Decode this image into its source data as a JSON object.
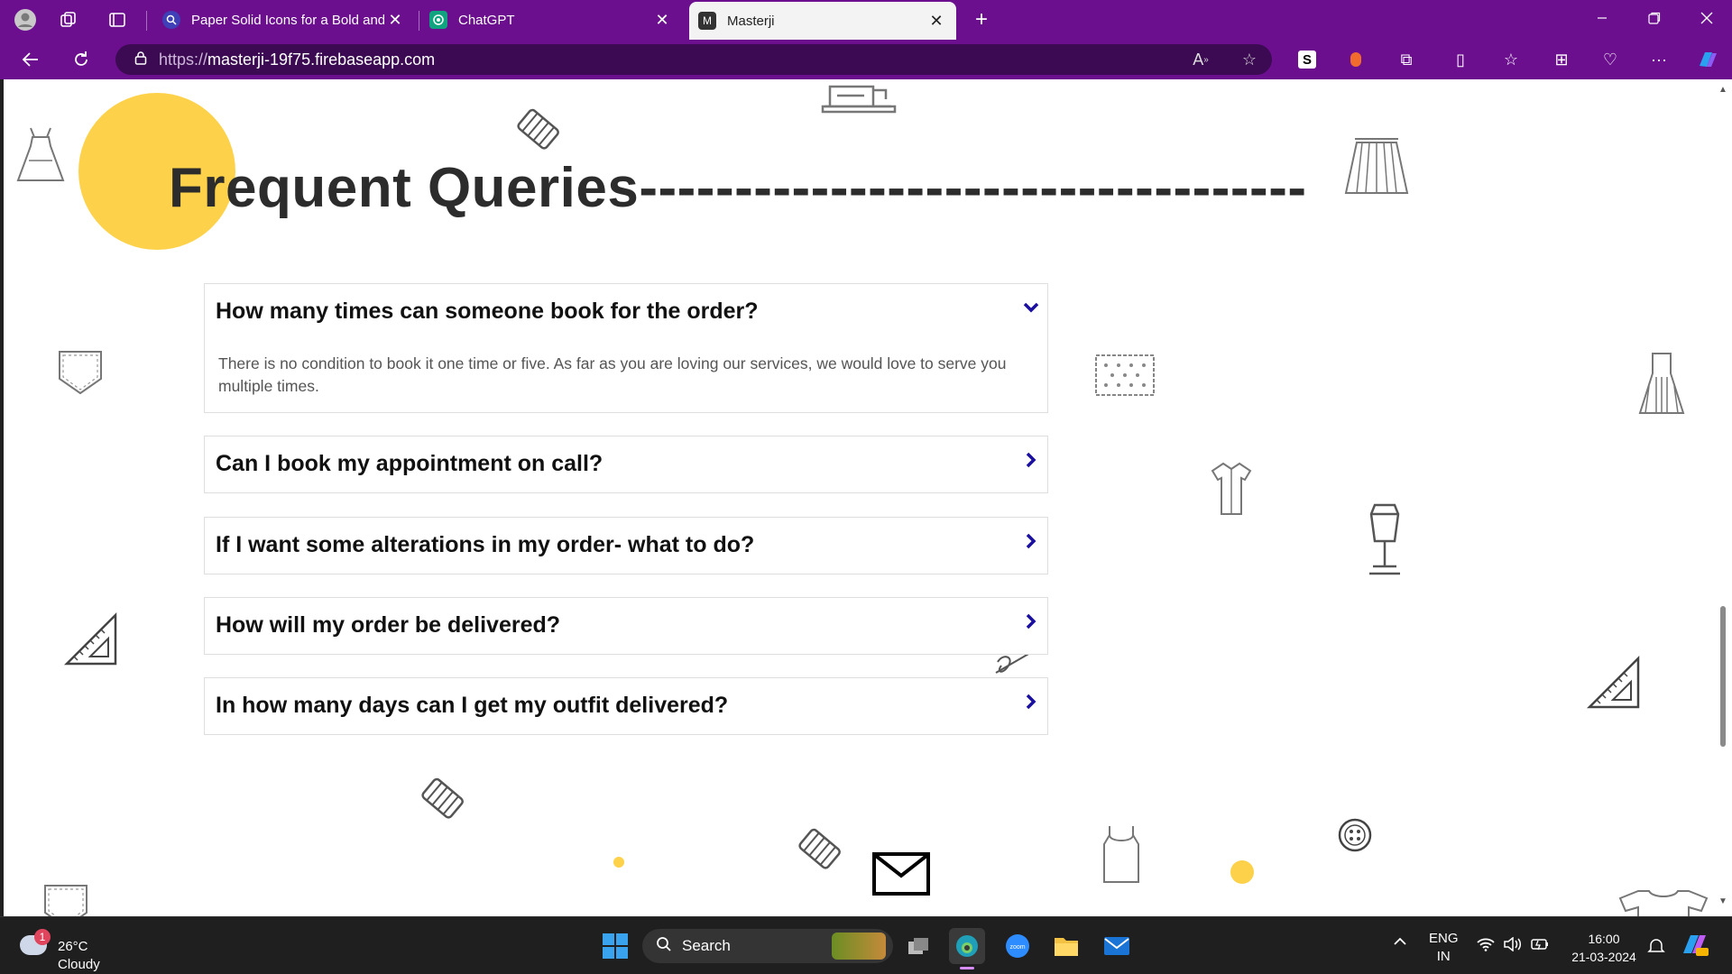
{
  "browser": {
    "tabs": [
      {
        "title": "Paper Solid Icons for a Bold and",
        "active": false
      },
      {
        "title": "ChatGPT",
        "active": false
      },
      {
        "title": "Masterji",
        "active": true
      }
    ],
    "url_protocol": "https://",
    "url_host": "masterji-19f75.firebaseapp.com",
    "accent": "#6b0f8e"
  },
  "page": {
    "heading": "Frequent Queries",
    "heading_dashes": "-----------------------------------",
    "accent_yellow": "#fdd24a",
    "chevron_color": "#1a0fa0",
    "faqs": [
      {
        "question": "How many times can someone book for the order?",
        "answer": "There is no condition to book it one time or five. As far as you are loving our services, we would love to serve you multiple times.",
        "expanded": true
      },
      {
        "question": "Can I book my appointment on call?",
        "expanded": false
      },
      {
        "question": "If I want some alterations in my order- what to do?",
        "expanded": false
      },
      {
        "question": "How will my order be delivered?",
        "expanded": false
      },
      {
        "question": "In how many days can I get my outfit delivered?",
        "expanded": false
      }
    ]
  },
  "taskbar": {
    "weather_badge": "1",
    "temperature": "26°C",
    "condition": "Cloudy",
    "search_label": "Search",
    "lang_top": "ENG",
    "lang_bottom": "IN",
    "time": "16:00",
    "date": "21-03-2024"
  }
}
